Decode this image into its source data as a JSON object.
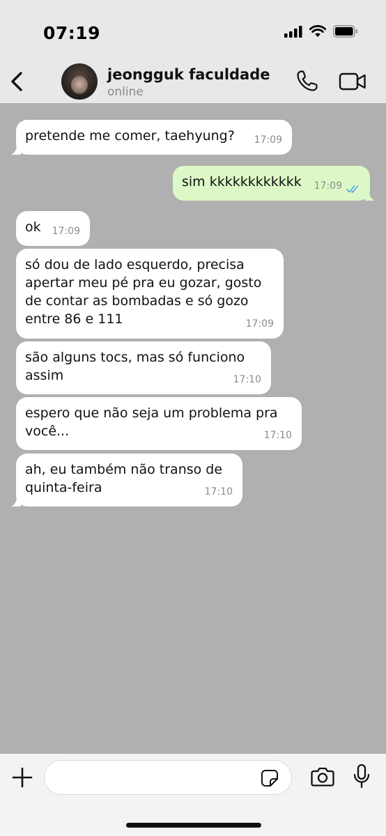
{
  "status_bar": {
    "time": "07:19"
  },
  "header": {
    "contact_name": "jeongguk faculdade",
    "contact_status": "online"
  },
  "messages": [
    {
      "direction": "incoming",
      "text": "pretende me comer, taehyung?",
      "time": "17:09"
    },
    {
      "direction": "outgoing",
      "text": "sim kkkkkkkkkkkk",
      "time": "17:09",
      "read": true
    },
    {
      "direction": "incoming",
      "text": "ok",
      "time": "17:09"
    },
    {
      "direction": "incoming",
      "lines": [
        "só dou de lado esquerdo, precisa",
        "apertar meu pé pra eu gozar, gosto",
        "de contar as bombadas e só gozo",
        "entre 86 e 111"
      ],
      "time": "17:09"
    },
    {
      "direction": "incoming",
      "lines": [
        "são alguns tocs, mas só funciono",
        "assim"
      ],
      "time": "17:10"
    },
    {
      "direction": "incoming",
      "lines": [
        "espero que não seja um problema pra",
        "você..."
      ],
      "time": "17:10"
    },
    {
      "direction": "incoming",
      "lines": [
        "ah, eu também não transo de",
        "quinta-feira"
      ],
      "time": "17:10"
    }
  ],
  "colors": {
    "chat_background": "#b0b0b0",
    "incoming_bubble": "#ffffff",
    "outgoing_bubble": "#dcf8c6",
    "read_ticks": "#4fa3e8"
  },
  "icons": [
    "back-chevron-icon",
    "phone-icon",
    "video-camera-icon",
    "plus-icon",
    "sticker-icon",
    "camera-icon",
    "microphone-icon"
  ]
}
